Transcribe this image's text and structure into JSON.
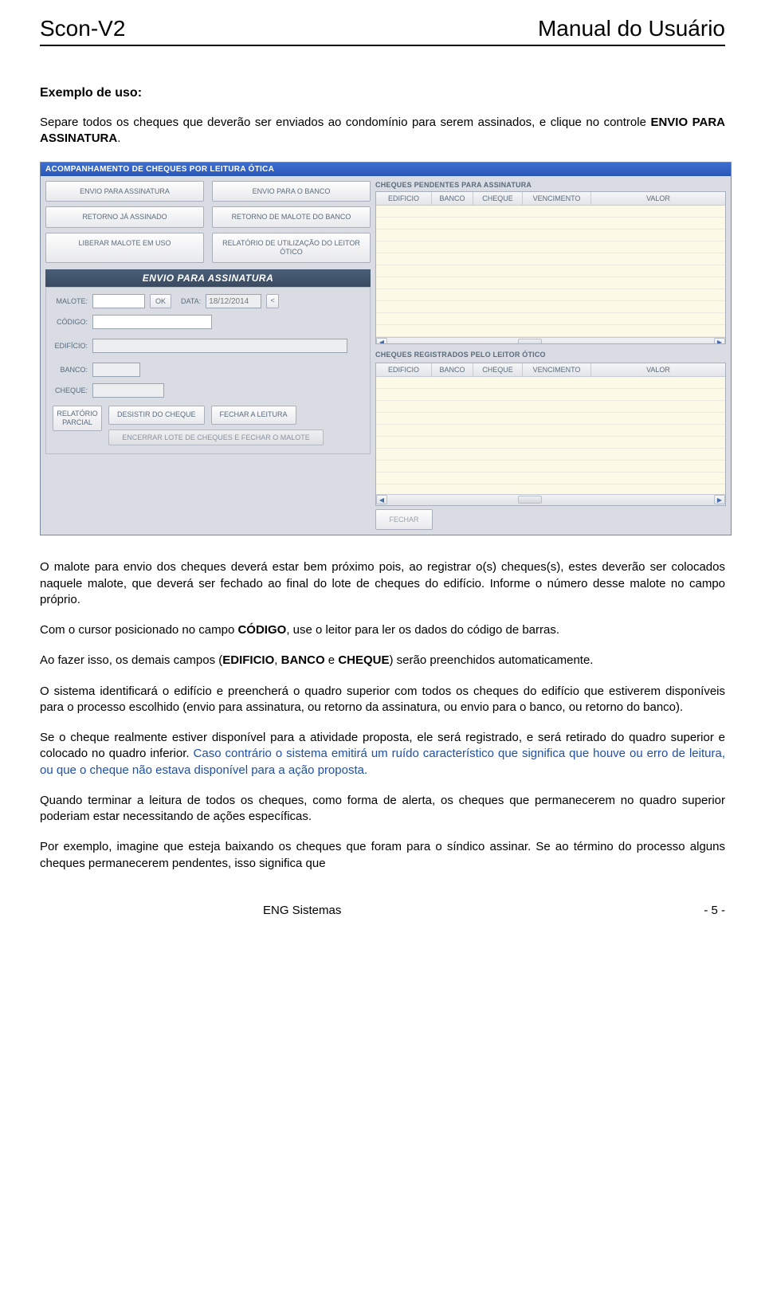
{
  "header": {
    "left": "Scon-V2",
    "right": "Manual do Usuário"
  },
  "section_title": "Exemplo de uso:",
  "intro_p1a": "Separe todos os cheques que deverão ser enviados ao condomínio para serem assinados, e clique no controle ",
  "intro_p1b": "ENVIO PARA ASSINATURA",
  "intro_p1c": ".",
  "app": {
    "title": "ACOMPANHAMENTO DE CHEQUES POR LEITURA ÓTICA",
    "buttons": {
      "envio_assinatura": "ENVIO PARA ASSINATURA",
      "envio_banco": "ENVIO PARA O BANCO",
      "retorno_assinado": "RETORNO JÁ ASSINADO",
      "retorno_malote": "RETORNO DE MALOTE DO BANCO",
      "liberar_malote": "LIBERAR MALOTE EM USO",
      "relatorio_leitor": "RELATÓRIO DE UTILIZAÇÃO  DO LEITOR ÓTICO"
    },
    "panel_title": "ENVIO PARA ASSINATURA",
    "form": {
      "malote_label": "MALOTE:",
      "ok": "OK",
      "data_label": "DATA:",
      "data_value": "18/12/2014",
      "date_prev": "<",
      "codigo_label": "CÓDIGO:",
      "edificio_label": "EDIFÍCIO:",
      "banco_label": "BANCO:",
      "cheque_label": "CHEQUE:",
      "relatorio_parcial": "RELATÓRIO PARCIAL",
      "desistir": "DESISTIR  DO CHEQUE",
      "fechar_leitura": "FECHAR  A LEITURA",
      "encerrar_lote": "ENCERRAR LOTE DE CHEQUES E FECHAR O MALOTE"
    },
    "right": {
      "pending_title": "CHEQUES PENDENTES PARA ASSINATURA",
      "registered_title": "CHEQUES REGISTRADOS PELO LEITOR ÓTICO",
      "cols": {
        "edificio": "EDIFICIO",
        "banco": "BANCO",
        "cheque": "CHEQUE",
        "vencimento": "VENCIMENTO",
        "valor": "VALOR"
      },
      "fechar": "FECHAR"
    }
  },
  "body": {
    "p1": "O malote para envio dos cheques deverá estar bem próximo pois, ao registrar o(s) cheques(s), estes deverão ser colocados naquele malote, que deverá ser fechado ao final do lote de cheques do edifício. Informe o número desse malote no campo próprio.",
    "p2a": "Com o cursor posicionado no campo ",
    "p2b": "CÓDIGO",
    "p2c": ", use o leitor para ler os dados do  código de barras.",
    "p3a": "Ao fazer isso, os demais campos (",
    "p3b": "EDIFICIO",
    "p3c": ", ",
    "p3d": "BANCO",
    "p3e": " e ",
    "p3f": "CHEQUE",
    "p3g": ") serão preenchidos automaticamente.",
    "p4": "O sistema identificará o edifício e preencherá o quadro superior com todos os cheques do edifício que estiverem disponíveis para o processo escolhido (envio para assinatura, ou retorno da assinatura, ou envio para o banco, ou retorno do banco).",
    "p5a": "Se o cheque realmente estiver disponível para a atividade proposta, ele será registrado, e será retirado do quadro superior e colocado no quadro inferior. ",
    "p5b": "Caso contrário o sistema emitirá um ruído característico que significa que houve ou erro de leitura, ou que o cheque não estava disponível para a ação proposta.",
    "p6": "Quando terminar a leitura de todos os cheques, como forma de alerta, os cheques que permanecerem no quadro superior poderiam estar necessitando de ações específicas.",
    "p7": "Por exemplo, imagine que esteja baixando os cheques que foram para o síndico assinar. Se ao término do processo alguns cheques permanecerem pendentes, isso significa que"
  },
  "footer": {
    "left": "ENG Sistemas",
    "right": "- 5 -"
  }
}
